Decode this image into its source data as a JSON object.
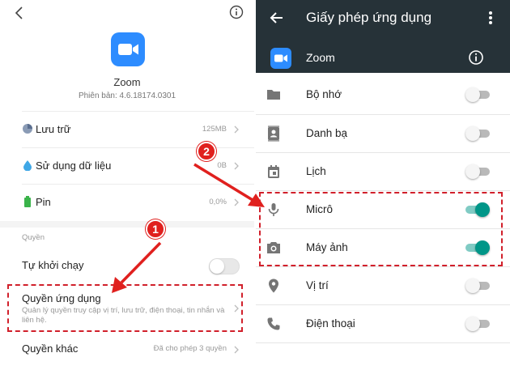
{
  "left": {
    "app_name": "Zoom",
    "version": "Phiên bản: 4.6.18174.0301",
    "rows": [
      {
        "label": "Lưu trữ",
        "value": "125MB",
        "icon": "pie-chart-icon"
      },
      {
        "label": "Sử dụng dữ liệu",
        "value": "0B",
        "icon": "water-drop-icon"
      },
      {
        "label": "Pin",
        "value": "0,0%",
        "icon": "battery-icon"
      }
    ],
    "section_label": "Quyền",
    "autostart": {
      "label": "Tự khởi chạy",
      "enabled": false
    },
    "permissions": {
      "title": "Quyền ứng dụng",
      "description": "Quản lý quyền truy cập vị trí, lưu trữ, điện thoại, tin nhắn và liên hệ."
    },
    "other": {
      "label": "Quyền khác",
      "value": "Đã cho phép 3 quyền"
    }
  },
  "right": {
    "title": "Giấy phép ứng dụng",
    "app_name": "Zoom",
    "permissions": [
      {
        "label": "Bộ nhớ",
        "enabled": false,
        "icon": "folder-icon"
      },
      {
        "label": "Danh bạ",
        "enabled": false,
        "icon": "contacts-icon"
      },
      {
        "label": "Lịch",
        "enabled": false,
        "icon": "calendar-icon"
      },
      {
        "label": "Micrô",
        "enabled": true,
        "icon": "microphone-icon"
      },
      {
        "label": "Máy ảnh",
        "enabled": true,
        "icon": "camera-icon"
      },
      {
        "label": "Vị trí",
        "enabled": false,
        "icon": "location-icon"
      },
      {
        "label": "Điện thoại",
        "enabled": false,
        "icon": "phone-icon"
      }
    ]
  },
  "annotations": {
    "step1": "1",
    "step2": "2"
  },
  "colors": {
    "header_bg": "#263238",
    "accent_teal": "#009688",
    "zoom_blue": "#2d8cff",
    "annotation_red": "#d1202b"
  }
}
